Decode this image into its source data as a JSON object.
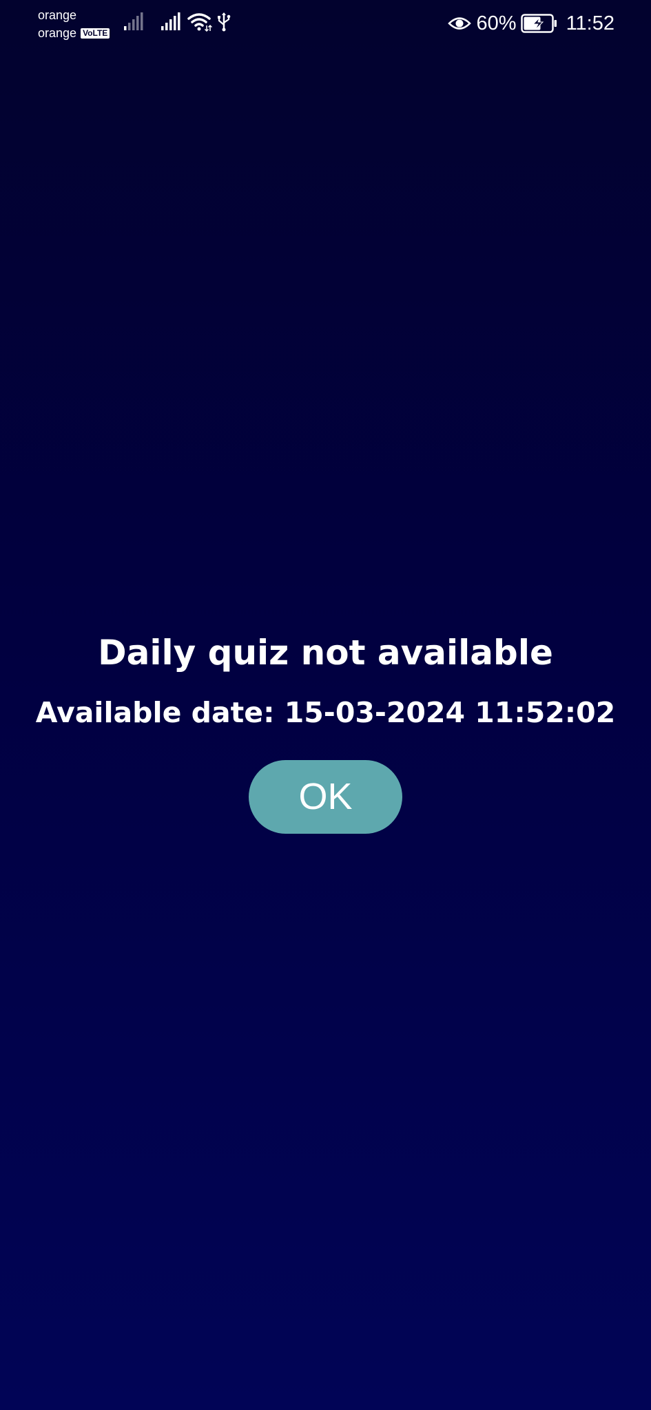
{
  "status_bar": {
    "carrier_1": "orange",
    "carrier_2": "orange",
    "volte": "VoLTE",
    "battery_percent": "60%",
    "time": "11:52",
    "icons": [
      "signal-weak-icon",
      "signal-icon",
      "wifi-icon",
      "usb-icon",
      "eye-icon",
      "battery-charging-icon"
    ]
  },
  "dialog": {
    "title": "Daily quiz not available",
    "message": "Available date: 15-03-2024 11:52:02",
    "ok_label": "OK"
  },
  "colors": {
    "background_top": "#02022e",
    "background_bottom": "#010456",
    "button": "#5ea8ae",
    "text": "#ffffff"
  }
}
